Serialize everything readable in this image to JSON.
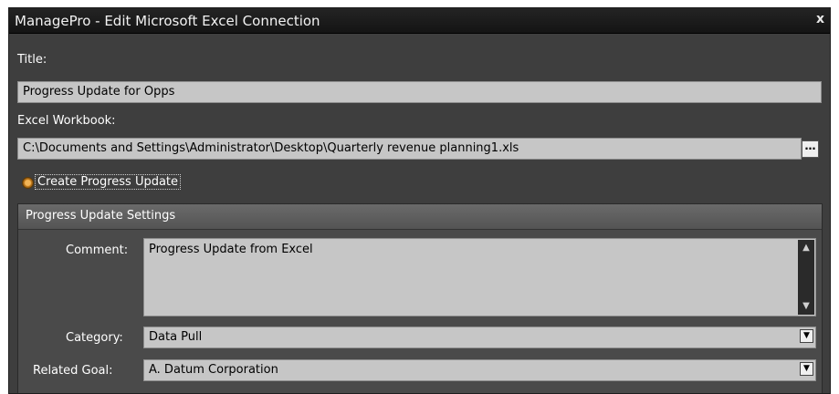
{
  "window": {
    "title": "ManagePro - Edit Microsoft Excel Connection",
    "close_glyph": "x"
  },
  "form": {
    "title_label": "Title:",
    "title_value": "Progress Update for Opps",
    "workbook_label": "Excel Workbook:",
    "workbook_value": "C:\\Documents and Settings\\Administrator\\Desktop\\Quarterly revenue planning1.xls",
    "browse_glyph": "…",
    "radio_label": "Create Progress Update",
    "radio_selected": true
  },
  "settings": {
    "header": "Progress Update Settings",
    "comment_label": "Comment:",
    "comment_value": "Progress Update from Excel",
    "category_label": "Category:",
    "category_value": "Data Pull",
    "goal_label": "Related Goal:",
    "goal_value": "A. Datum Corporation"
  },
  "colors": {
    "window_bg": "#3e3e3e",
    "field_bg": "#c6c6c6",
    "radio_accent": "#f1b457"
  }
}
